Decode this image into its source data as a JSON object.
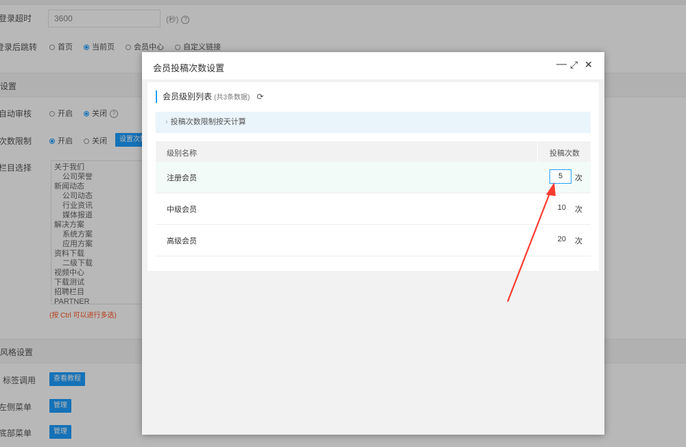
{
  "background": {
    "login_timeout_label": "登录超时",
    "login_timeout_value": "3600",
    "login_timeout_unit": "(秒)",
    "redirect_label": "登录后跳转",
    "redirect_options": [
      "首页",
      "当前页",
      "会员中心",
      "自定义链接"
    ],
    "section1_title": "设置",
    "auto_review_label": "自动审核",
    "auto_review_options": [
      "开启",
      "关闭"
    ],
    "limit_label": "次数限制",
    "limit_options": [
      "开启",
      "关闭"
    ],
    "limit_button": "设置次数",
    "column_label": "栏目选择",
    "column_items": [
      {
        "label": "关于我们",
        "level": 0
      },
      {
        "label": "公司荣誉",
        "level": 1
      },
      {
        "label": "新闻动态",
        "level": 0
      },
      {
        "label": "公司动态",
        "level": 1
      },
      {
        "label": "行业资讯",
        "level": 1
      },
      {
        "label": "媒体报道",
        "level": 1
      },
      {
        "label": "解决方案",
        "level": 0
      },
      {
        "label": "系统方案",
        "level": 1
      },
      {
        "label": "应用方案",
        "level": 1
      },
      {
        "label": "资料下载",
        "level": 0
      },
      {
        "label": "二级下载",
        "level": 1
      },
      {
        "label": "视频中心",
        "level": 0
      },
      {
        "label": "下载测试",
        "level": 0
      },
      {
        "label": "招聘栏目",
        "level": 0
      },
      {
        "label": "PARTNER",
        "level": 0
      }
    ],
    "column_hint": "(按 Ctrl 可以进行多选)",
    "section2_title": "风格设置",
    "tag_label": "标签调用",
    "tag_button": "查看教程",
    "left_menu_label": "左侧菜单",
    "left_menu_button": "管理",
    "bottom_menu_label": "底部菜单",
    "bottom_menu_button": "管理"
  },
  "dialog": {
    "title": "会员投稿次数设置",
    "minimize": "—",
    "maximize": "⤢",
    "close": "✕",
    "list_title": "会员级别列表",
    "list_count": "(共3条数据)",
    "refresh_icon": "refresh-icon",
    "notice": "投稿次数限制按天计算",
    "columns": [
      "级别名称",
      "投稿次数"
    ],
    "rows": [
      {
        "name": "注册会员",
        "count": "5",
        "unit": "次",
        "editing": true
      },
      {
        "name": "中级会员",
        "count": "10",
        "unit": "次",
        "editing": false
      },
      {
        "name": "高级会员",
        "count": "20",
        "unit": "次",
        "editing": false
      }
    ]
  },
  "annotation": {
    "arrow_color": "#ff3b30"
  },
  "colors": {
    "accent": "#1e9fff",
    "hint": "#ff5722"
  }
}
